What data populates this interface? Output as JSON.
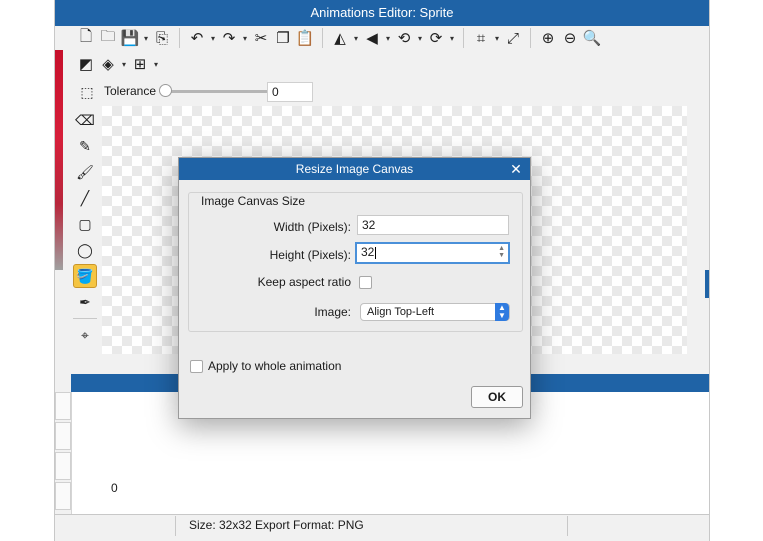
{
  "window": {
    "title": "Animations Editor: Sprite"
  },
  "toolbar": {
    "row1": [
      {
        "name": "new-file-icon",
        "glyph": "🗋"
      },
      {
        "name": "open-folder-icon",
        "glyph": "🗀"
      },
      {
        "name": "save-icon",
        "glyph": "💾",
        "dropdown": true
      },
      {
        "name": "export-icon",
        "glyph": "⎘"
      },
      {
        "sep": true
      },
      {
        "name": "undo-icon",
        "glyph": "↶",
        "dropdown": true
      },
      {
        "name": "redo-icon",
        "glyph": "↷",
        "dropdown": true
      },
      {
        "name": "cut-icon",
        "glyph": "✂"
      },
      {
        "name": "copy-icon",
        "glyph": "❐"
      },
      {
        "name": "paste-icon",
        "glyph": "📋"
      },
      {
        "sep": true
      },
      {
        "name": "flip-horizontal-icon",
        "glyph": "◭",
        "dropdown": true
      },
      {
        "name": "flip-vertical-icon",
        "glyph": "◀",
        "dropdown": true
      },
      {
        "name": "rotate-left-icon",
        "glyph": "⟲",
        "dropdown": true
      },
      {
        "name": "rotate-right-icon",
        "glyph": "⟳",
        "dropdown": true
      },
      {
        "sep": true
      },
      {
        "name": "crop-icon",
        "glyph": "⌗",
        "dropdown": true
      },
      {
        "name": "resize-icon",
        "glyph": "⤢"
      },
      {
        "sep": true
      },
      {
        "name": "zoom-in-icon",
        "glyph": "⊕"
      },
      {
        "name": "zoom-out-icon",
        "glyph": "⊖"
      },
      {
        "name": "zoom-fit-icon",
        "glyph": "🔍"
      }
    ],
    "row2": [
      {
        "name": "color-swap-icon",
        "glyph": "◩"
      },
      {
        "name": "layers-icon",
        "glyph": "◈",
        "dropdown": true
      },
      {
        "name": "grid-icon",
        "glyph": "⊞",
        "dropdown": true
      }
    ]
  },
  "tolerance": {
    "label": "Tolerance",
    "value": "0",
    "level": 0
  },
  "tools": [
    {
      "name": "select-marquee-icon",
      "glyph": "⬚"
    },
    {
      "name": "eraser-icon",
      "glyph": "⌫"
    },
    {
      "name": "pencil-icon",
      "glyph": "✎"
    },
    {
      "name": "brush-icon",
      "glyph": "🖌"
    },
    {
      "name": "line-icon",
      "glyph": "╱"
    },
    {
      "name": "rectangle-icon",
      "glyph": "▢"
    },
    {
      "name": "ellipse-icon",
      "glyph": "◯"
    },
    {
      "name": "paint-bucket-icon",
      "glyph": "🪣",
      "active": true
    },
    {
      "name": "eyedropper-icon",
      "glyph": "✒"
    },
    {
      "sep": true
    },
    {
      "name": "hotspot-icon",
      "glyph": "⌖"
    }
  ],
  "timeline": {
    "frame_label": "0"
  },
  "status": {
    "text": "Size: 32x32   Export Format: PNG"
  },
  "dialog": {
    "title": "Resize Image Canvas",
    "group_title": "Image Canvas Size",
    "width_label": "Width (Pixels):",
    "width_value": "32",
    "height_label": "Height (Pixels):",
    "height_value": "32",
    "keep_aspect_label": "Keep aspect ratio",
    "image_label": "Image:",
    "image_value": "Align Top-Left",
    "apply_all_label": "Apply to whole animation",
    "ok_label": "OK"
  },
  "colors": {
    "accent": "#1f63a6",
    "active_tool": "#f5c542",
    "focus": "#4a90d9"
  }
}
